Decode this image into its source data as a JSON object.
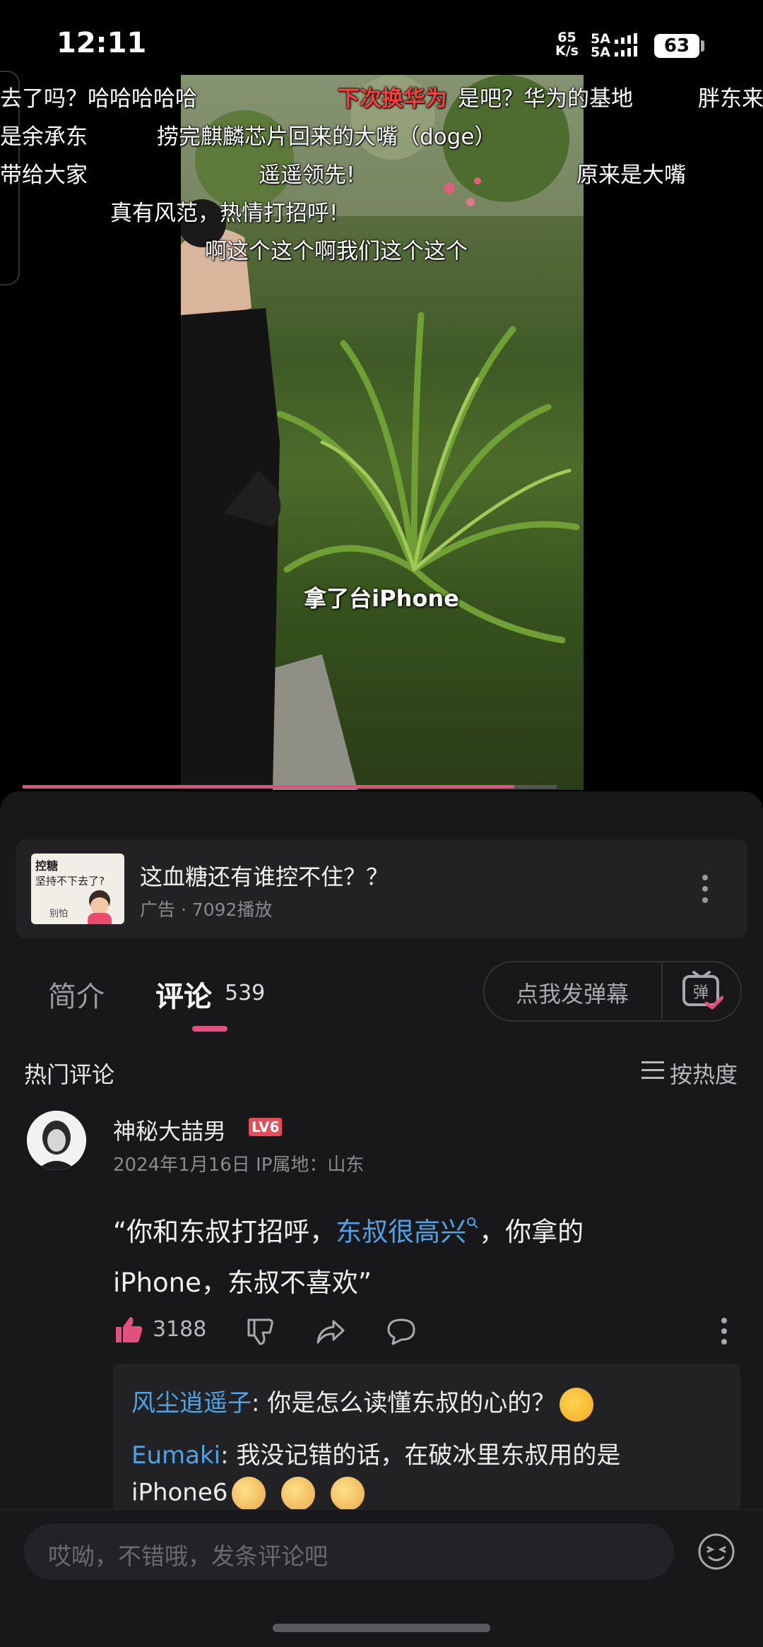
{
  "status_bar": {
    "time": "12:11",
    "net_speed_value": "65",
    "net_speed_unit": "K/s",
    "sig1": "5A",
    "sig2": "5A",
    "battery": "63"
  },
  "video": {
    "danmaku": [
      "去了吗？哈哈哈哈哈",
      "下次换华为",
      "是吧？华为的基地",
      "胖东来",
      "是余承东",
      "捞完麒麟芯片回来的大嘴（doge）",
      "带给大家",
      "遥遥领先!",
      "原来是大嘴",
      "真有风范，热情打招呼!",
      "啊这个这个啊我们这个这个"
    ],
    "caption": "拿了台iPhone",
    "progress": 0.92
  },
  "ad": {
    "thumb_text_1": "控糖",
    "thumb_text_2": "坚持不下去了?",
    "thumb_text_3": "别怕",
    "title": "这血糖还有谁控不住？？",
    "meta": "广告 · 7092播放"
  },
  "tabs": {
    "intro": "简介",
    "comments": "评论",
    "comment_count": "539",
    "danmaku_button": "点我发弹幕",
    "danmaku_icon_text": "弹"
  },
  "comments": {
    "section_title": "热门评论",
    "sort_label": "按热度",
    "top": {
      "username": "神秘大喆男",
      "level": "LV6",
      "date_location": "2024年1月16日 IP属地：山东",
      "text_before": "“你和东叔打招呼，",
      "text_link": "东叔很高兴",
      "text_after": "，你拿的iPhone，东叔不喜欢”",
      "likes": "3188"
    },
    "replies": [
      {
        "name": "风尘逍遥子",
        "text": ": 你是怎么读懂东叔的心的？"
      },
      {
        "name": "Eumaki",
        "text": ": 我没记错的话，在破冰里东叔用的是",
        "text2": "iPhone6"
      }
    ]
  },
  "input": {
    "placeholder": "哎呦，不错哦，发条评论吧"
  },
  "colors": {
    "accent": "#e0517e",
    "link": "#4ea3e6",
    "panel_bg": "#18181a"
  }
}
